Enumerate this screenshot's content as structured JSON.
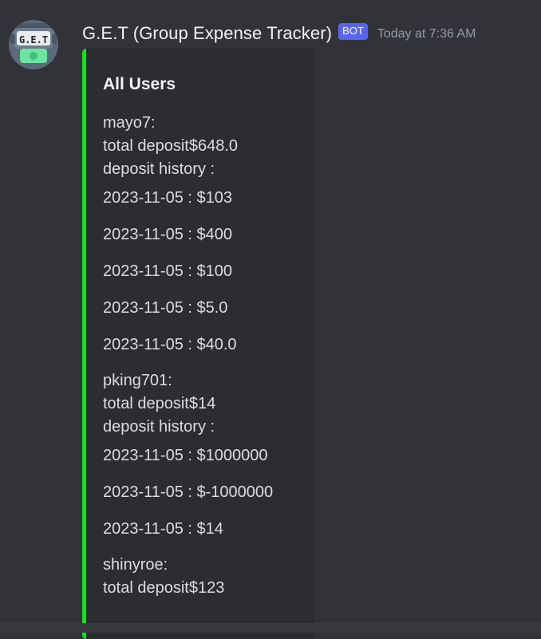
{
  "message": {
    "author": "G.E.T (Group Expense Tracker)",
    "bot_tag": "BOT",
    "timestamp": "Today at 7:36 AM",
    "avatar_text": "G.E.T"
  },
  "embed": {
    "accent_color": "#11e51a",
    "title": "All Users",
    "users": [
      {
        "name": "mayo7:",
        "total": "total deposit$648.0",
        "history_label": "deposit history :",
        "history": [
          "2023-11-05 : $103",
          "2023-11-05 : $400",
          "2023-11-05 : $100",
          "2023-11-05 : $5.0",
          "2023-11-05 : $40.0"
        ]
      },
      {
        "name": "pking701:",
        "total": "total deposit$14",
        "history_label": "deposit history :",
        "history": [
          "2023-11-05 : $1000000",
          "2023-11-05 : $-1000000",
          "2023-11-05 : $14"
        ]
      },
      {
        "name": "shinyroe:",
        "total": "total deposit$123",
        "history_label": "",
        "history": []
      }
    ]
  }
}
